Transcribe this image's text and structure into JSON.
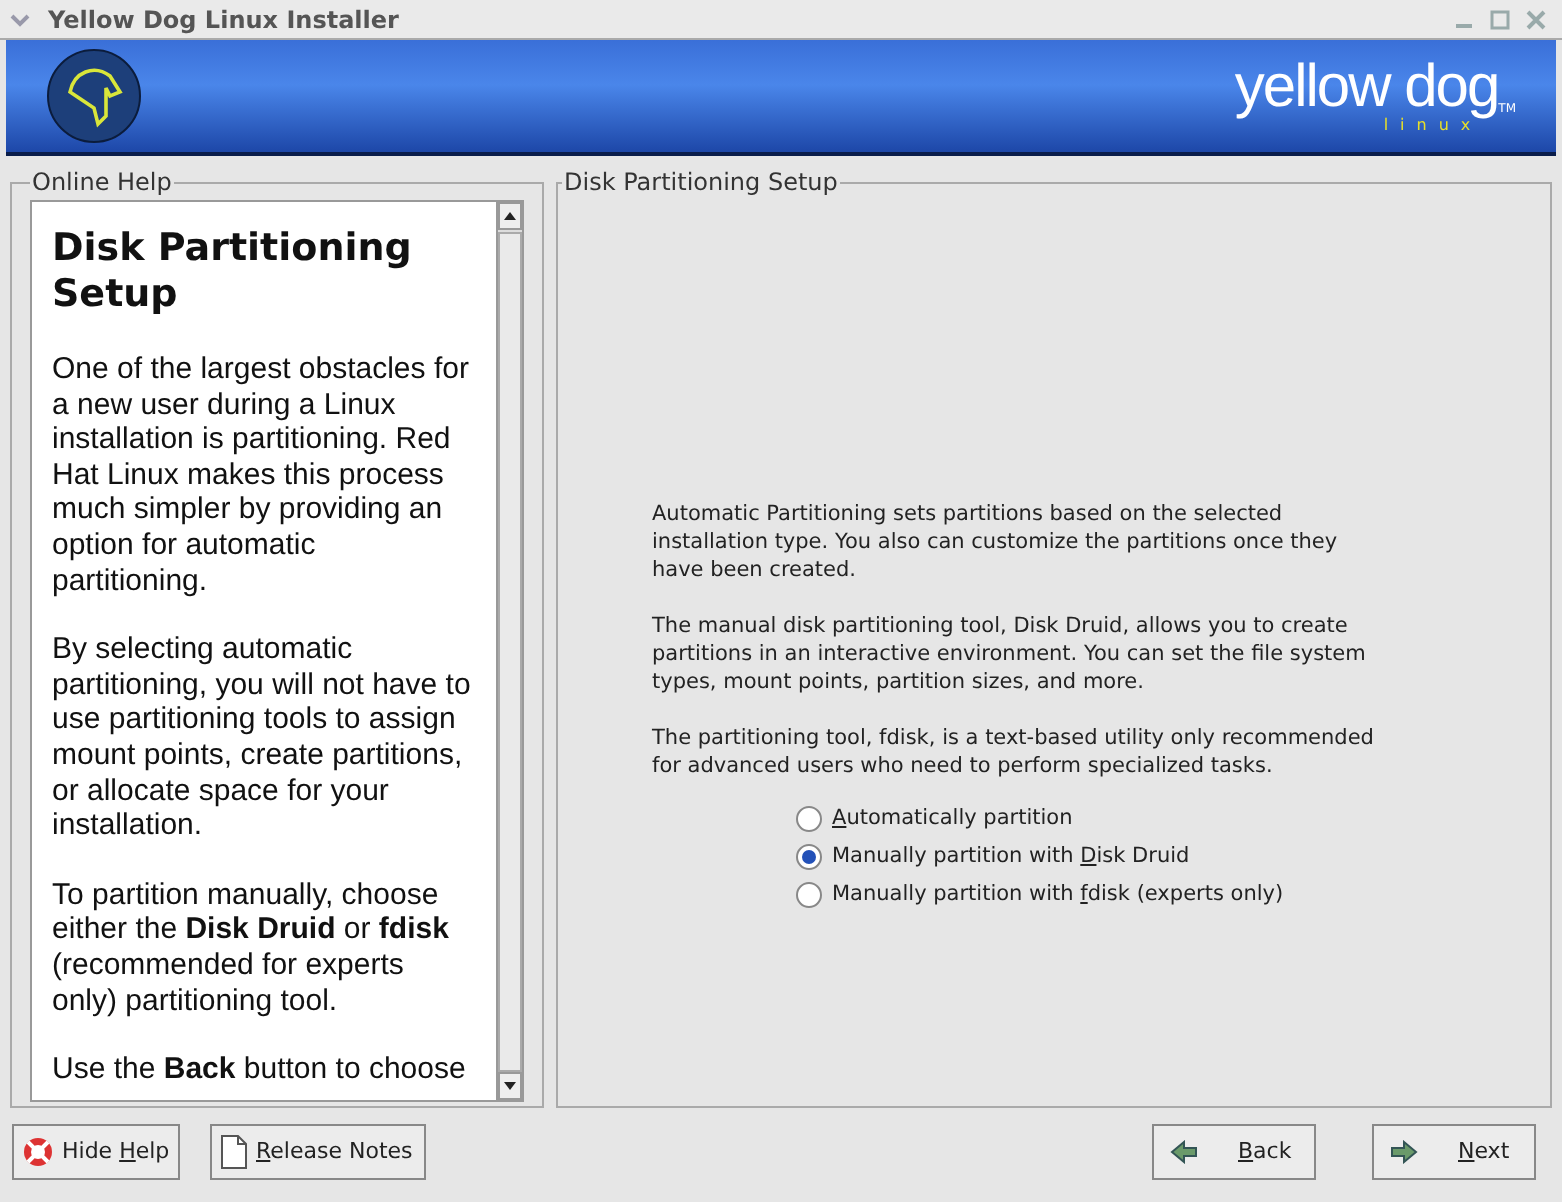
{
  "window": {
    "title": "Yellow Dog Linux Installer"
  },
  "banner": {
    "logo_text": "yellow dog",
    "logo_sub": "linux",
    "trademark": "TM"
  },
  "help": {
    "legend": "Online Help",
    "heading": "Disk Partitioning Setup",
    "paragraphs": [
      "One of the largest obstacles for a new user during a Linux installation is partitioning. Red Hat Linux makes this process much simpler by providing an option for automatic partitioning.",
      "By selecting automatic partitioning, you will not have to use partitioning tools to assign mount points, create partitions, or allocate space for your installation.",
      "To partition manually, choose either the **Disk Druid** or **fdisk** (recommended for experts only) partitioning tool.",
      "Use the **Back** button to choose"
    ]
  },
  "main": {
    "legend": "Disk Partitioning Setup",
    "paragraphs": [
      "Automatic Partitioning sets partitions based on the selected installation type. You also can customize the partitions once they have been created.",
      "The manual disk partitioning tool, Disk Druid, allows you to create partitions in an interactive environment. You can set the file system types, mount points, partition sizes, and more.",
      "The partitioning tool, fdisk, is a text-based utility only recommended for advanced users who need to perform specialized tasks."
    ],
    "options": [
      {
        "key": "A",
        "after": "utomatically partition",
        "selected": false
      },
      {
        "before": "Manually partition with ",
        "key": "D",
        "after": "isk Druid",
        "selected": true
      },
      {
        "before": "Manually partition with ",
        "key": "f",
        "after": "disk (experts only)",
        "selected": false
      }
    ]
  },
  "buttons": [
    {
      "kind": "help",
      "before": "Hide ",
      "key": "H",
      "after": "elp"
    },
    {
      "kind": "notes",
      "key": "R",
      "after": "elease Notes"
    },
    {
      "kind": "back",
      "key": "B",
      "after": "ack"
    },
    {
      "kind": "next",
      "key": "N",
      "after": "ext"
    }
  ]
}
